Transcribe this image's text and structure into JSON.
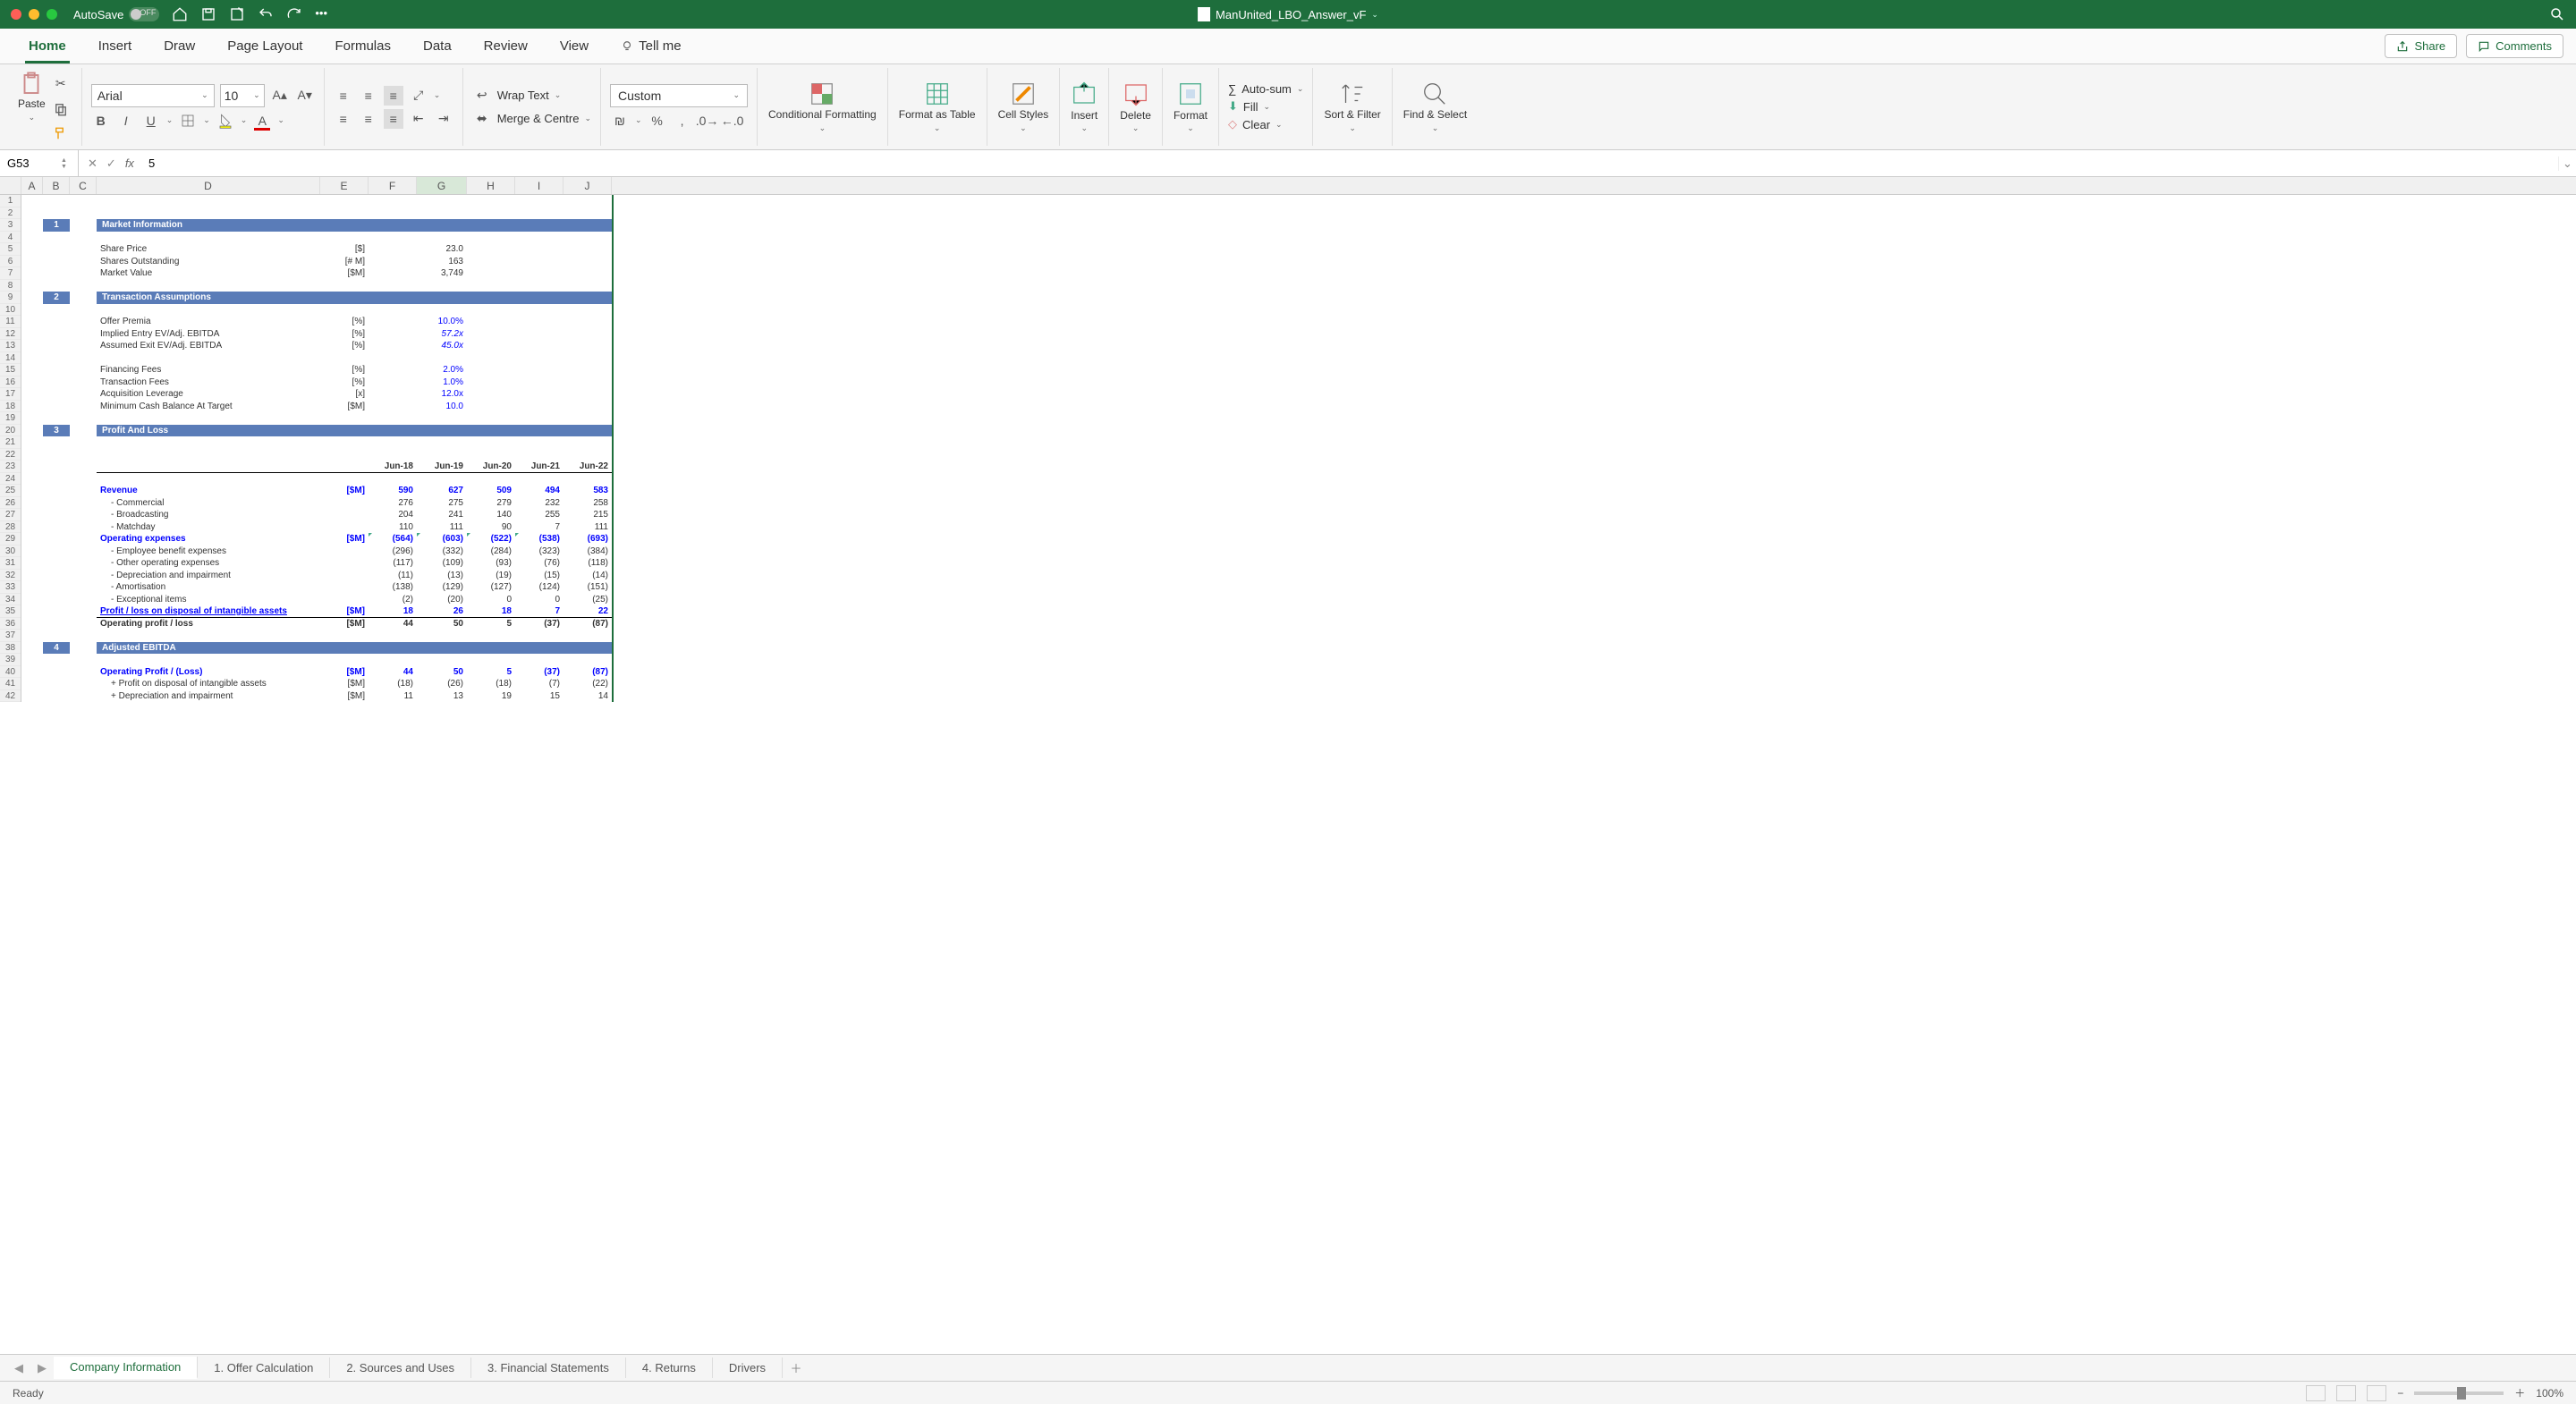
{
  "window": {
    "autosave_label": "AutoSave",
    "autosave_state": "OFF",
    "title": "ManUnited_LBO_Answer_vF"
  },
  "tabs": [
    "Home",
    "Insert",
    "Draw",
    "Page Layout",
    "Formulas",
    "Data",
    "Review",
    "View",
    "Tell me"
  ],
  "active_tab": "Home",
  "share_btn": "Share",
  "comments_btn": "Comments",
  "ribbon": {
    "paste": "Paste",
    "font_name": "Arial",
    "font_size": "10",
    "wrap_text": "Wrap Text",
    "merge_centre": "Merge & Centre",
    "number_format": "Custom",
    "cond_fmt": "Conditional Formatting",
    "fmt_table": "Format as Table",
    "cell_styles": "Cell Styles",
    "insert": "Insert",
    "delete": "Delete",
    "format": "Format",
    "autosum": "Auto-sum",
    "fill": "Fill",
    "clear": "Clear",
    "sort_filter": "Sort & Filter",
    "find_select": "Find & Select"
  },
  "name_box": "G53",
  "formula_bar": "5",
  "columns": [
    "A",
    "B",
    "C",
    "D",
    "E",
    "F",
    "G",
    "H",
    "I",
    "J"
  ],
  "rows_visible": 42,
  "selected_col": "G",
  "sections": {
    "s1": {
      "num": "1",
      "title": "Market Information"
    },
    "s2": {
      "num": "2",
      "title": "Transaction Assumptions"
    },
    "s3": {
      "num": "3",
      "title": "Profit And Loss"
    },
    "s4": {
      "num": "4",
      "title": "Adjusted EBITDA"
    }
  },
  "market": {
    "r1": {
      "label": "Share Price",
      "unit": "[$]",
      "val": "23.0"
    },
    "r2": {
      "label": "Shares Outstanding",
      "unit": "[# M]",
      "val": "163"
    },
    "r3": {
      "label": "Market Value",
      "unit": "[$M]",
      "val": "3,749"
    }
  },
  "trans": {
    "r1": {
      "label": "Offer Premia",
      "unit": "[%]",
      "val": "10.0%"
    },
    "r2": {
      "label": "Implied Entry EV/Adj. EBITDA",
      "unit": "[%]",
      "val": "57.2x"
    },
    "r3": {
      "label": "Assumed Exit EV/Adj. EBITDA",
      "unit": "[%]",
      "val": "45.0x"
    },
    "r4": {
      "label": "Financing Fees",
      "unit": "[%]",
      "val": "2.0%"
    },
    "r5": {
      "label": "Transaction Fees",
      "unit": "[%]",
      "val": "1.0%"
    },
    "r6": {
      "label": "Acquisition Leverage",
      "unit": "[x]",
      "val": "12.0x"
    },
    "r7": {
      "label": "Minimum Cash Balance At Target",
      "unit": "[$M]",
      "val": "10.0"
    }
  },
  "pl_headers": [
    "Jun-18",
    "Jun-19",
    "Jun-20",
    "Jun-21",
    "Jun-22"
  ],
  "pl": {
    "revenue": {
      "label": "Revenue",
      "unit": "[$M]",
      "v": [
        "590",
        "627",
        "509",
        "494",
        "583"
      ]
    },
    "commercial": {
      "label": "- Commercial",
      "v": [
        "276",
        "275",
        "279",
        "232",
        "258"
      ]
    },
    "broadcasting": {
      "label": "- Broadcasting",
      "v": [
        "204",
        "241",
        "140",
        "255",
        "215"
      ]
    },
    "matchday": {
      "label": "- Matchday",
      "v": [
        "110",
        "111",
        "90",
        "7",
        "111"
      ]
    },
    "opex": {
      "label": "Operating expenses",
      "unit": "[$M]",
      "v": [
        "(564)",
        "(603)",
        "(522)",
        "(538)",
        "(693)"
      ]
    },
    "emp": {
      "label": "- Employee benefit expenses",
      "v": [
        "(296)",
        "(332)",
        "(284)",
        "(323)",
        "(384)"
      ]
    },
    "other": {
      "label": "- Other operating expenses",
      "v": [
        "(117)",
        "(109)",
        "(93)",
        "(76)",
        "(118)"
      ]
    },
    "depr": {
      "label": "- Depreciation and impairment",
      "v": [
        "(11)",
        "(13)",
        "(19)",
        "(15)",
        "(14)"
      ]
    },
    "amort": {
      "label": "- Amortisation",
      "v": [
        "(138)",
        "(129)",
        "(127)",
        "(124)",
        "(151)"
      ]
    },
    "excep": {
      "label": "- Exceptional items",
      "v": [
        "(2)",
        "(20)",
        "0",
        "0",
        "(25)"
      ]
    },
    "disposal": {
      "label": "Profit / loss on disposal of intangible assets",
      "unit": "[$M]",
      "v": [
        "18",
        "26",
        "18",
        "7",
        "22"
      ]
    },
    "opprofit": {
      "label": "Operating profit / loss",
      "unit": "[$M]",
      "v": [
        "44",
        "50",
        "5",
        "(37)",
        "(87)"
      ]
    }
  },
  "ebitda": {
    "op": {
      "label": "Operating Profit / (Loss)",
      "unit": "[$M]",
      "v": [
        "44",
        "50",
        "5",
        "(37)",
        "(87)"
      ]
    },
    "disp": {
      "label": "+ Profit on disposal of intangible assets",
      "unit": "[$M]",
      "v": [
        "(18)",
        "(26)",
        "(18)",
        "(7)",
        "(22)"
      ]
    },
    "depr": {
      "label": "+ Depreciation and impairment",
      "unit": "[$M]",
      "v": [
        "11",
        "13",
        "19",
        "15",
        "14"
      ]
    }
  },
  "sheet_tabs": [
    "Company Information",
    "1. Offer Calculation",
    "2. Sources and Uses",
    "3. Financial Statements",
    "4. Returns",
    "Drivers"
  ],
  "active_sheet": "Company Information",
  "status": "Ready",
  "zoom": "100%"
}
